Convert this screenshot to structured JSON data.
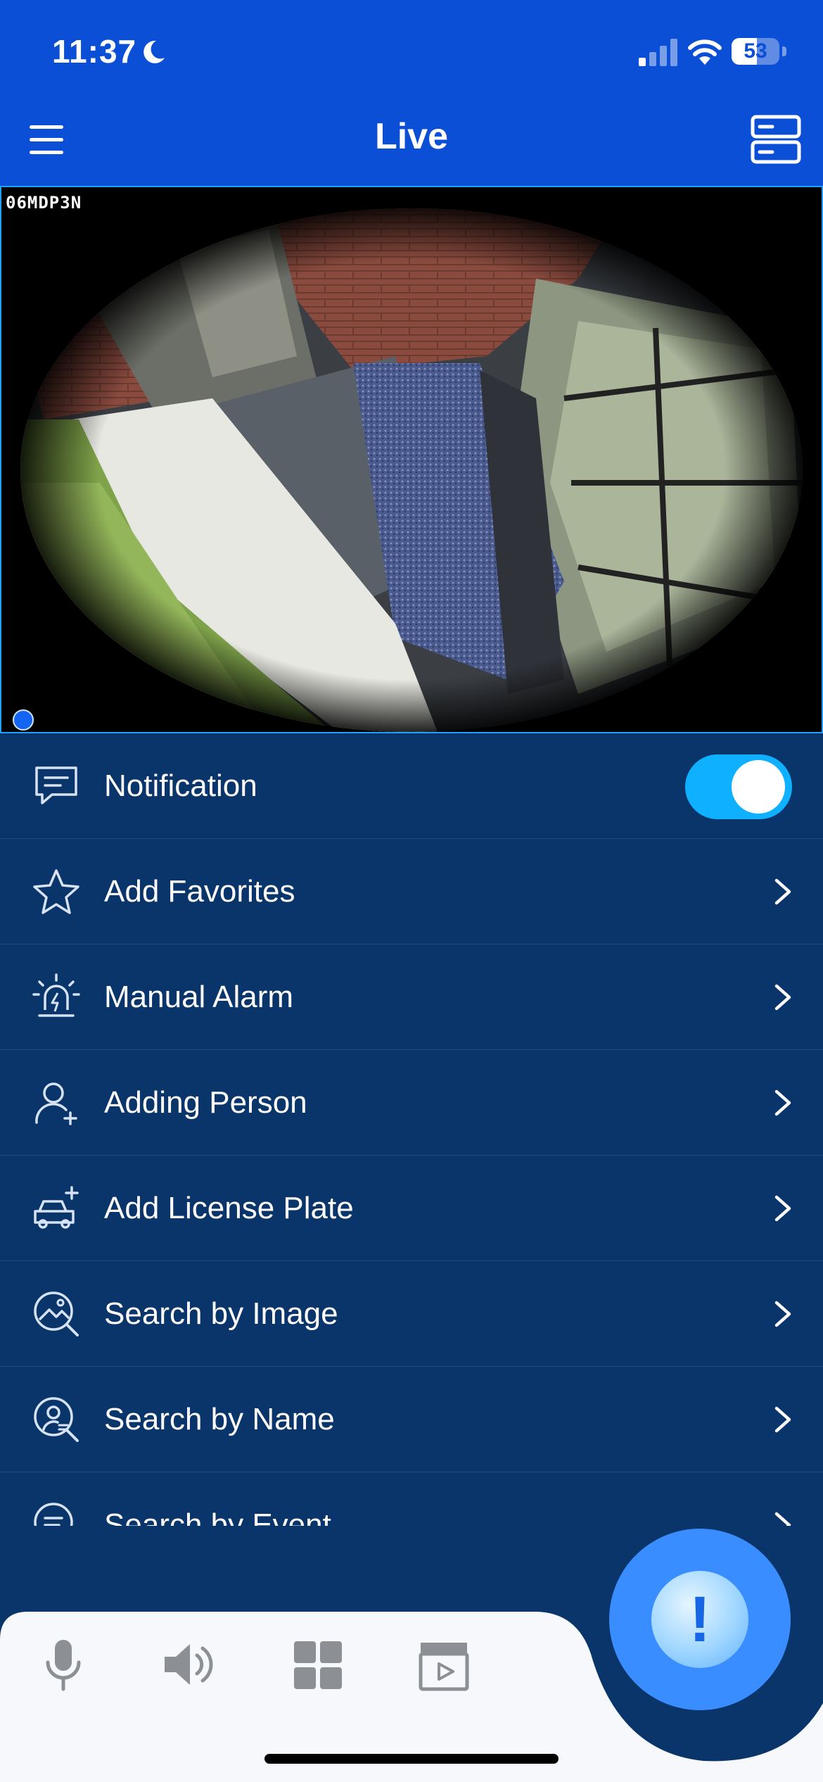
{
  "status_bar": {
    "time": "11:37",
    "battery": "53",
    "battery_level": 0.53
  },
  "header": {
    "title": "Live"
  },
  "video": {
    "camera_label": "06MDP3N"
  },
  "menu": {
    "items": [
      {
        "label": "Notification",
        "icon": "message-icon",
        "control": "toggle",
        "toggle_on": true
      },
      {
        "label": "Add Favorites",
        "icon": "star-icon",
        "control": "chevron"
      },
      {
        "label": "Manual Alarm",
        "icon": "alarm-siren-icon",
        "control": "chevron"
      },
      {
        "label": "Adding Person",
        "icon": "person-add-icon",
        "control": "chevron"
      },
      {
        "label": "Add License Plate",
        "icon": "car-add-icon",
        "control": "chevron"
      },
      {
        "label": "Search by Image",
        "icon": "image-search-icon",
        "control": "chevron"
      },
      {
        "label": "Search by Name",
        "icon": "name-search-icon",
        "control": "chevron"
      },
      {
        "label": "Search by Event",
        "icon": "event-search-icon",
        "control": "chevron"
      }
    ]
  },
  "toolbar": {
    "icons": [
      "microphone-icon",
      "speaker-icon",
      "grid-layout-icon",
      "playback-clapper-icon"
    ],
    "alert_button": "!"
  },
  "colors": {
    "header_blue": "#0b4fd6",
    "list_background": "#0a356a",
    "toggle_on": "#0fb0ff",
    "alert_blue": "#3a8dff"
  }
}
